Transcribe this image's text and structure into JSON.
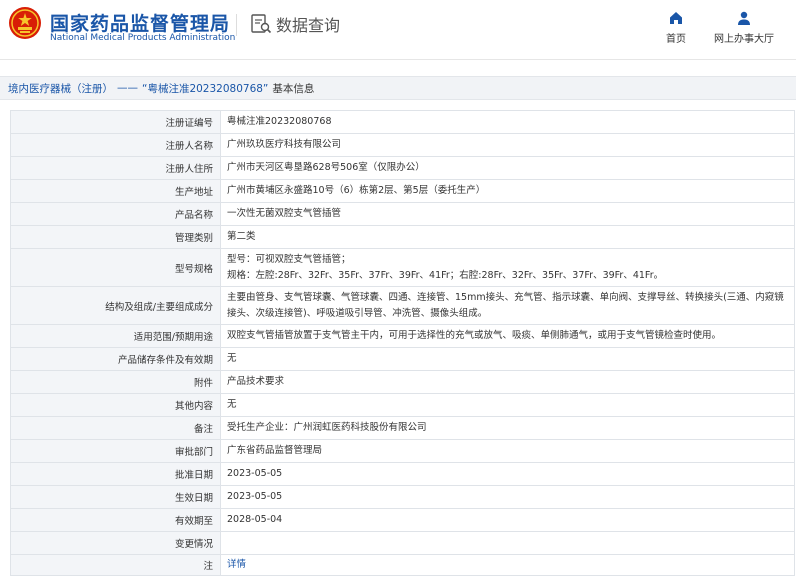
{
  "header": {
    "title": "国家药品监督管理局",
    "subtitle": "National Medical Products Administration",
    "section": "数据查询",
    "nav": {
      "home": "首页",
      "personal": "网上办事大厅"
    },
    "colors": {
      "brand": "#1a56a8",
      "emblem_red": "#d81e06",
      "emblem_gold": "#f7c52b"
    }
  },
  "breadcrumb": {
    "category": "境内医疗器械（注册）",
    "separator": "——",
    "record": "“粤械注准20232080768”",
    "suffix": "基本信息"
  },
  "fields": [
    {
      "label": "注册证编号",
      "value": "粤械注准20232080768"
    },
    {
      "label": "注册人名称",
      "value": "广州玖玖医疗科技有限公司"
    },
    {
      "label": "注册人住所",
      "value": "广州市天河区粤垦路628号506室（仅限办公）"
    },
    {
      "label": "生产地址",
      "value": "广州市黄埔区永盛路10号（6）栋第2层、第5层（委托生产）"
    },
    {
      "label": "产品名称",
      "value": "一次性无菌双腔支气管插管"
    },
    {
      "label": "管理类别",
      "value": "第二类"
    },
    {
      "label": "型号规格",
      "value_lines": [
        "型号：可视双腔支气管插管；",
        "规格：左腔:28Fr、32Fr、35Fr、37Fr、39Fr、41Fr；右腔:28Fr、32Fr、35Fr、37Fr、39Fr、41Fr。"
      ]
    },
    {
      "label": "结构及组成/主要组成成分",
      "value_lines": [
        "主要由管身、支气管球囊、气管球囊、四通、连接管、15mm接头、充气管、指示球囊、单向阀、支撑导丝、转换接头(三通、内窥镜",
        "接头、次级连接管)、呼吸道吸引导管、冲洗管、摄像头组成。"
      ]
    },
    {
      "label": "适用范围/预期用途",
      "value": "双腔支气管插管放置于支气管主干内，可用于选择性的充气或放气、吸痰、单侧肺通气，或用于支气管镜检查时使用。"
    },
    {
      "label": "产品储存条件及有效期",
      "value": "无"
    },
    {
      "label": "附件",
      "value": "产品技术要求"
    },
    {
      "label": "其他内容",
      "value": "无"
    },
    {
      "label": "备注",
      "value": "受托生产企业：广州润虹医药科技股份有限公司"
    },
    {
      "label": "审批部门",
      "value": "广东省药品监督管理局"
    },
    {
      "label": "批准日期",
      "value": "2023-05-05"
    },
    {
      "label": "生效日期",
      "value": "2023-05-05"
    },
    {
      "label": "有效期至",
      "value": "2028-05-04"
    },
    {
      "label": "变更情况",
      "value": ""
    },
    {
      "label": "注",
      "value": "详情"
    }
  ]
}
